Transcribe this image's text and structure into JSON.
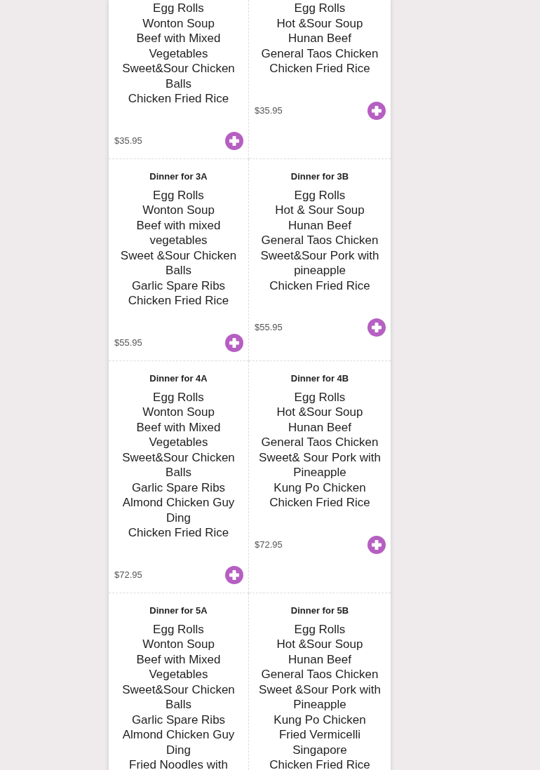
{
  "combos": [
    {
      "items": [
        "Egg Rolls",
        "Wonton Soup",
        "Beef with Mixed Vegetables",
        "Sweet&Sour Chicken Balls",
        "Chicken Fried Rice"
      ],
      "price": "$35.95"
    },
    {
      "items": [
        "Egg Rolls",
        "Hot &Sour Soup",
        "Hunan Beef",
        "General Taos Chicken",
        "Chicken Fried Rice"
      ],
      "price": "$35.95"
    },
    {
      "title": "Dinner for 3A",
      "items": [
        "Egg Rolls",
        "Wonton Soup",
        "Beef with mixed vegetables",
        "Sweet &Sour Chicken Balls",
        "Garlic Spare Ribs",
        "Chicken Fried Rice"
      ],
      "price": "$55.95"
    },
    {
      "title": "Dinner for 3B",
      "items": [
        "Egg Rolls",
        "Hot & Sour Soup",
        "Hunan Beef",
        "General Taos Chicken",
        "Sweet&Sour Pork with pineapple",
        "Chicken Fried Rice"
      ],
      "price": "$55.95"
    },
    {
      "title": "Dinner for 4A",
      "items": [
        "Egg Rolls",
        "Wonton Soup",
        "Beef with Mixed Vegetables",
        "Sweet&Sour Chicken Balls",
        "Garlic Spare Ribs",
        "Almond Chicken Guy Ding",
        "Chicken Fried Rice"
      ],
      "price": "$72.95"
    },
    {
      "title": "Dinner for 4B",
      "items": [
        "Egg Rolls",
        "Hot &Sour Soup",
        "Hunan Beef",
        "General Taos Chicken",
        "Sweet& Sour Pork with Pineapple",
        "Kung Po Chicken",
        "Chicken Fried Rice"
      ],
      "price": "$72.95"
    },
    {
      "title": "Dinner for 5A",
      "items": [
        "Egg Rolls",
        "Wonton Soup",
        "Beef with Mixed Vegetables",
        "Sweet&Sour Chicken Balls",
        "Garlic Spare Ribs",
        "Almond Chicken Guy Ding",
        "Fried Noodles with"
      ]
    },
    {
      "title": "Dinner for 5B",
      "items": [
        "Egg Rolls",
        "Hot &Sour Soup",
        "Hunan Beef",
        "General Taos Chicken",
        "Sweet &Sour Pork with Pineapple",
        "Kung Po Chicken",
        "Fried Vermicelli Singapore",
        "Chicken Fried Rice"
      ]
    }
  ]
}
